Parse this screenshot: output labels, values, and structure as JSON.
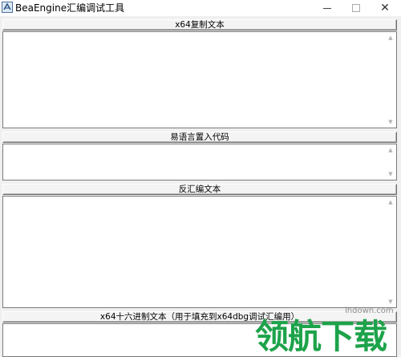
{
  "window": {
    "title": "BeaEngine汇编调试工具",
    "icon": "app-icon",
    "controls": {
      "minimize_icon": "minimize-icon",
      "maximize_icon": "maximize-icon",
      "close_symbol": "✕"
    }
  },
  "sections": [
    {
      "label": "x64复制文本",
      "value": ""
    },
    {
      "label": "易语言置入代码",
      "value": ""
    },
    {
      "label": "反汇编文本",
      "value": ""
    },
    {
      "label": "x64十六进制文本（用于填充到x64dbg调试汇编用）",
      "value": ""
    }
  ],
  "watermark": {
    "url": "lhdown.com",
    "text": "领航下载"
  },
  "colors": {
    "window_bg": "#f0f0f0",
    "textbox_bg": "#ffffff",
    "watermark_green": "#1da34a"
  }
}
